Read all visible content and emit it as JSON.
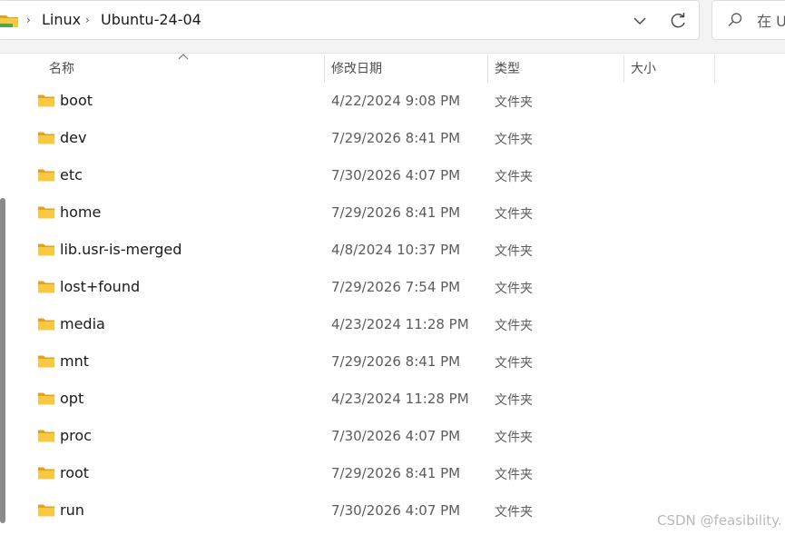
{
  "address_bar": {
    "crumbs": [
      "Linux",
      "Ubuntu-24-04"
    ]
  },
  "search": {
    "placeholder": "在 U"
  },
  "columns": {
    "name": "名称",
    "date": "修改日期",
    "type": "类型",
    "size": "大小"
  },
  "files": [
    {
      "name": "boot",
      "modified": "4/22/2024 9:08 PM",
      "type": "文件夹"
    },
    {
      "name": "dev",
      "modified": "7/29/2026 8:41 PM",
      "type": "文件夹"
    },
    {
      "name": "etc",
      "modified": "7/30/2026 4:07 PM",
      "type": "文件夹"
    },
    {
      "name": "home",
      "modified": "7/29/2026 8:41 PM",
      "type": "文件夹"
    },
    {
      "name": "lib.usr-is-merged",
      "modified": "4/8/2024 10:37 PM",
      "type": "文件夹"
    },
    {
      "name": "lost+found",
      "modified": "7/29/2026 7:54 PM",
      "type": "文件夹"
    },
    {
      "name": "media",
      "modified": "4/23/2024 11:28 PM",
      "type": "文件夹"
    },
    {
      "name": "mnt",
      "modified": "7/29/2026 8:41 PM",
      "type": "文件夹"
    },
    {
      "name": "opt",
      "modified": "4/23/2024 11:28 PM",
      "type": "文件夹"
    },
    {
      "name": "proc",
      "modified": "7/30/2026 4:07 PM",
      "type": "文件夹"
    },
    {
      "name": "root",
      "modified": "7/29/2026 8:41 PM",
      "type": "文件夹"
    },
    {
      "name": "run",
      "modified": "7/30/2026 4:07 PM",
      "type": "文件夹"
    }
  ],
  "watermark": "CSDN @feasibility.",
  "icons": {
    "folder": "folder-icon",
    "separator": "chevron-right-icon",
    "dropdown": "chevron-down-icon",
    "refresh": "refresh-icon",
    "search": "search-icon",
    "sort": "sort-up-icon"
  },
  "colors": {
    "folder_yellow": "#f7c843",
    "folder_dark": "#e3a21a",
    "text": "#1a1a1a",
    "muted": "#5c5c5c"
  }
}
